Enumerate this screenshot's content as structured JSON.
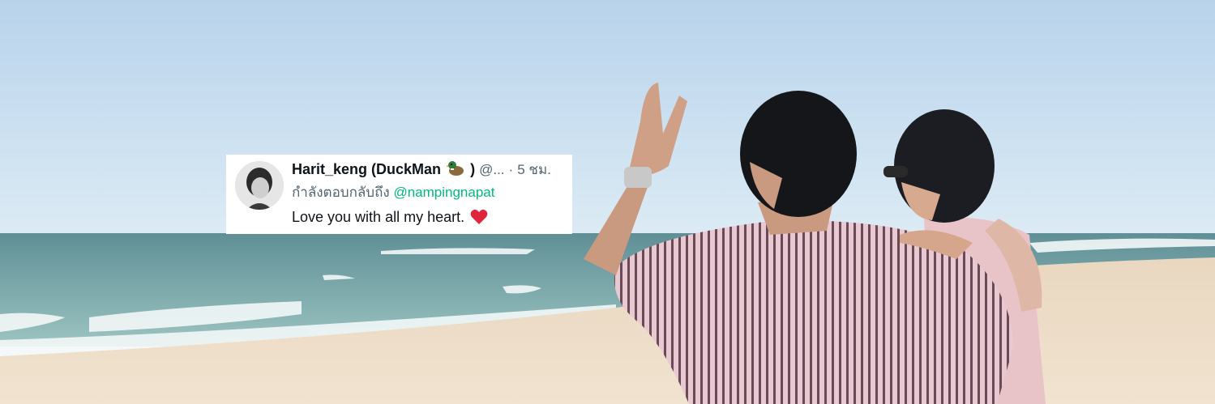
{
  "tweet": {
    "display_name": "Harit_keng (DuckMan",
    "display_name_close": ")",
    "handle": "@...",
    "separator": "·",
    "time": "5 ชม.",
    "reply_prefix": "กำลังตอบกลับถึง",
    "reply_to": "@nampingnapat",
    "text": "Love you with all my heart."
  },
  "icons": {
    "duck": "duck-emoji-icon",
    "heart": "red-heart-emoji-icon"
  },
  "colors": {
    "sky": "#c4dcf0",
    "sea": "#6f9ea3",
    "sand": "#ecdcc6",
    "mention": "#00ba7c",
    "meta_text": "#536471"
  }
}
